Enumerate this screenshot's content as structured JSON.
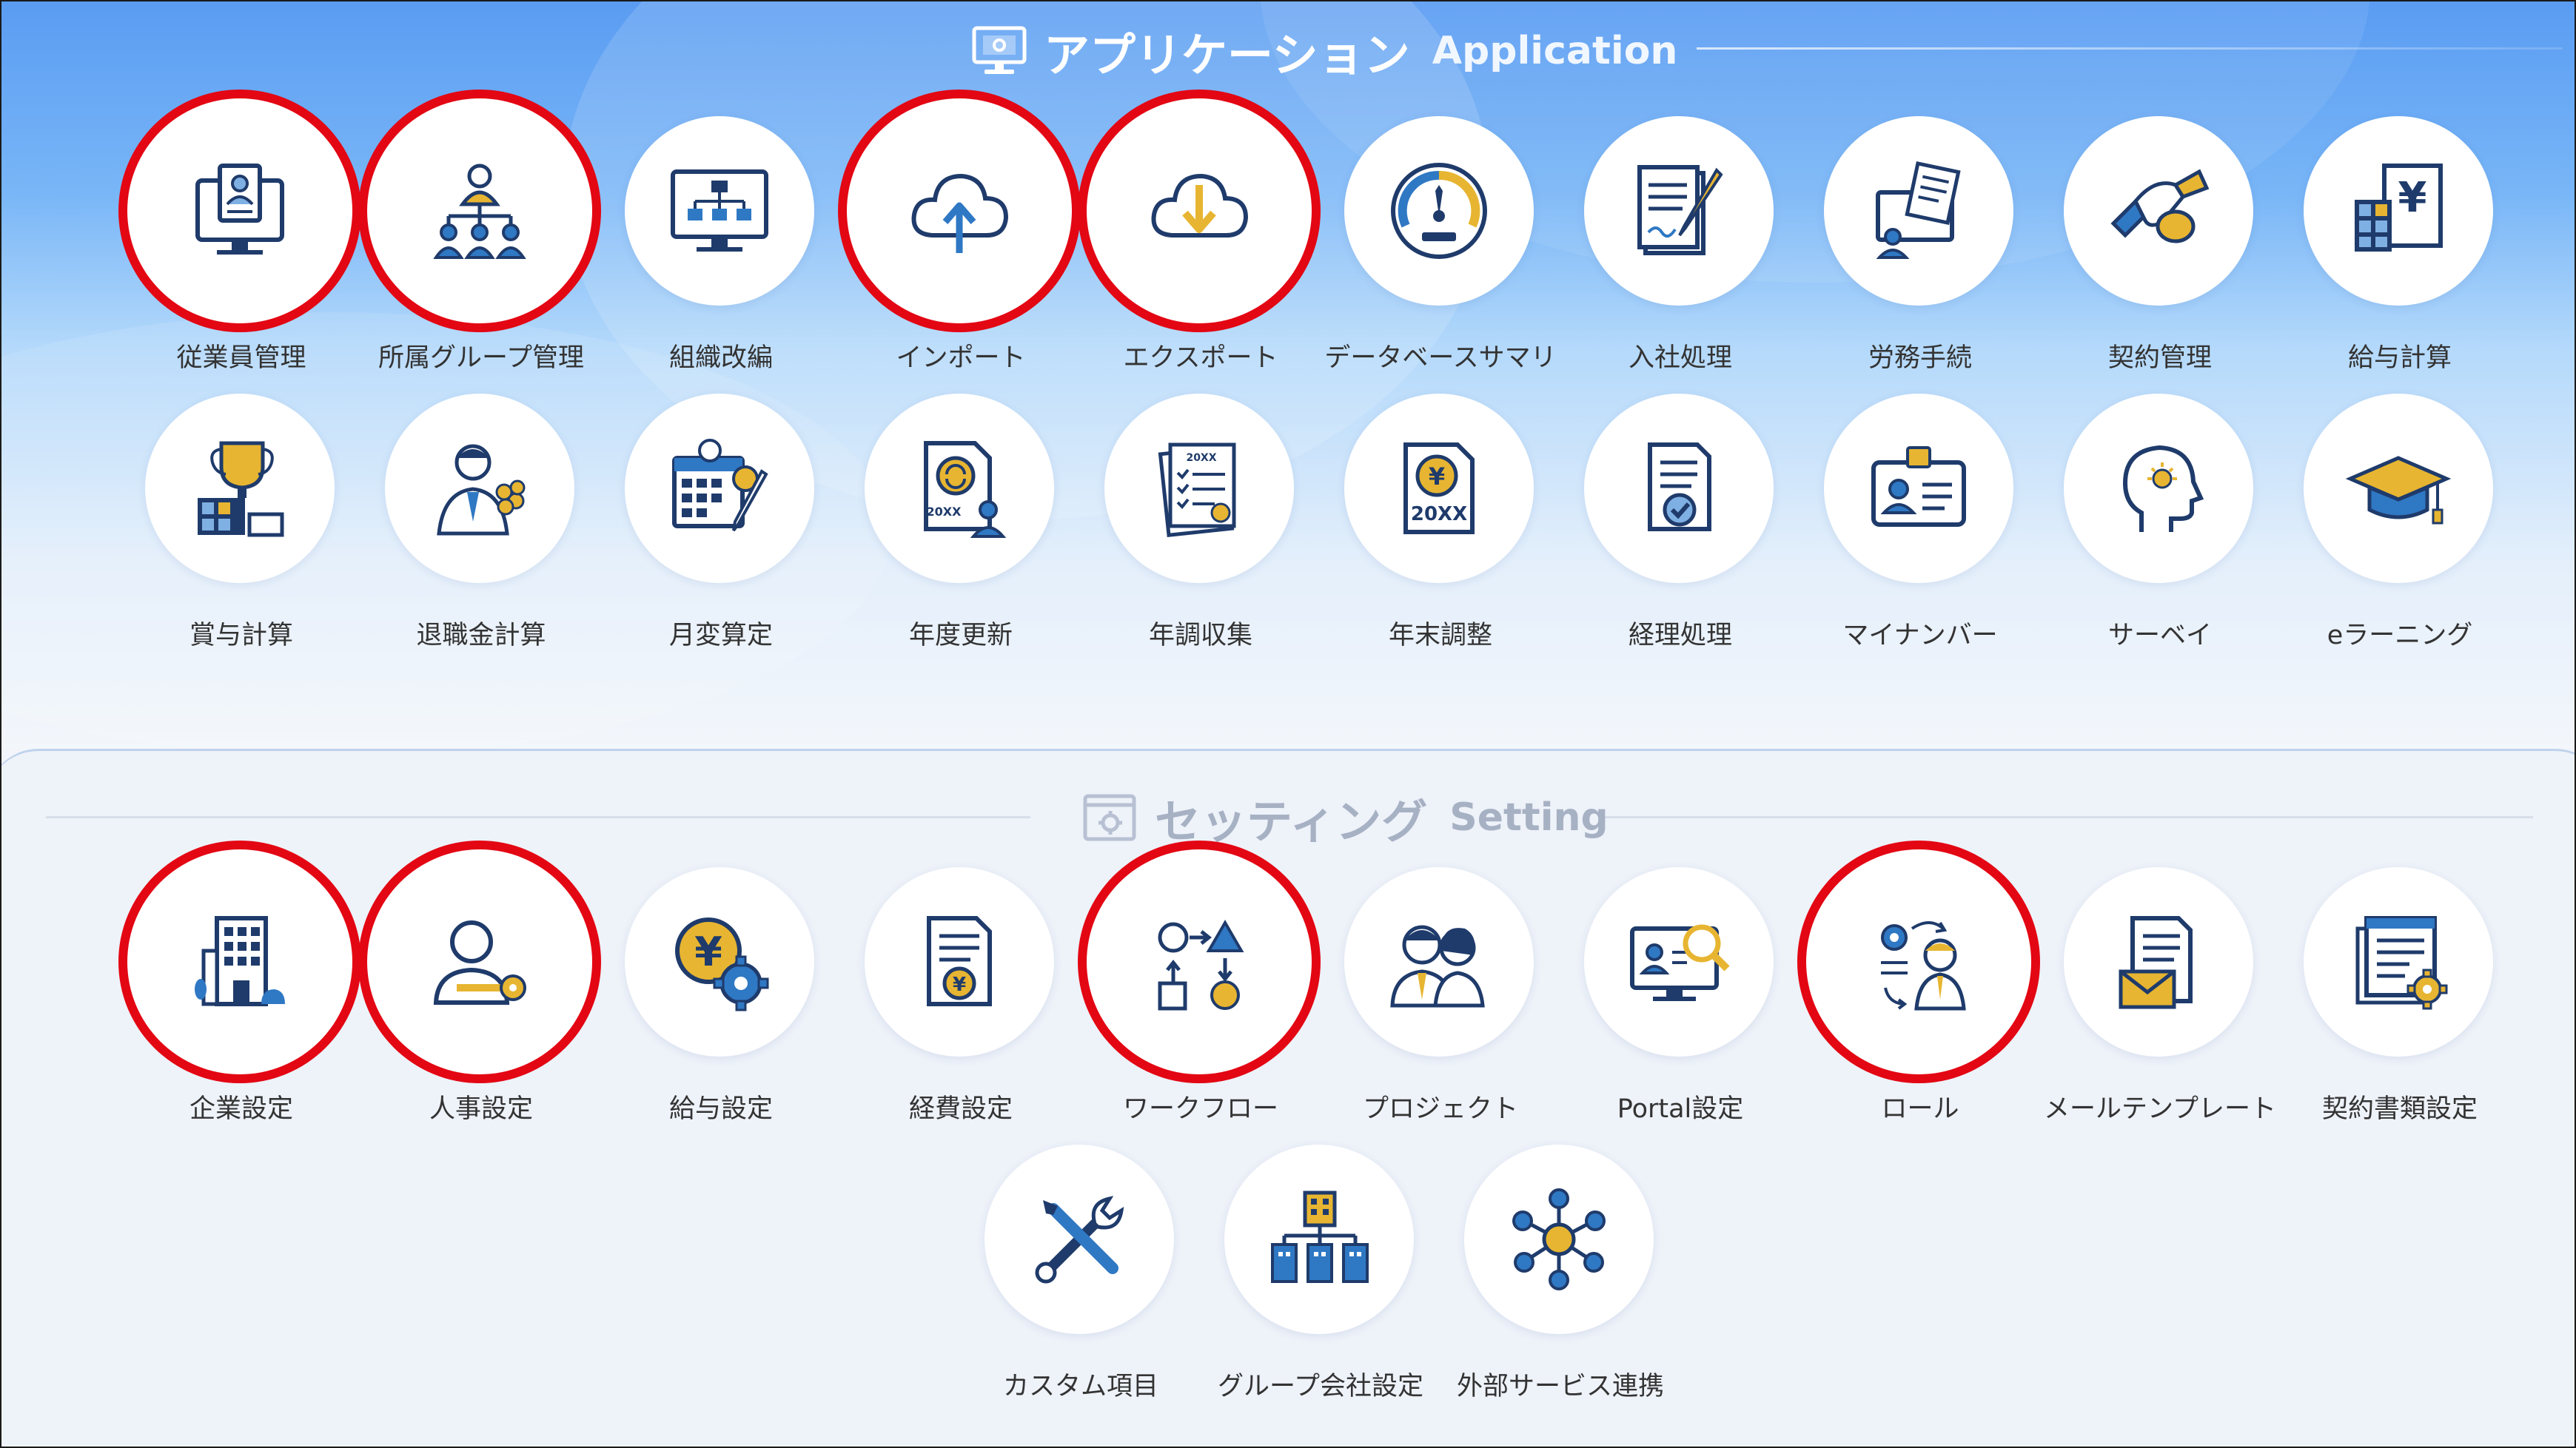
{
  "application_section": {
    "title_jp": "アプリケーション",
    "title_en": "Application",
    "icon": "monitor-settings-icon"
  },
  "setting_section": {
    "title_jp": "セッティング",
    "title_en": "Setting",
    "icon": "window-gear-icon"
  },
  "colors": {
    "highlight_ring": "#e30613",
    "icon_navy": "#1f3b6b",
    "icon_gold": "#e7b531",
    "icon_blue": "#2f78c4"
  },
  "application_tiles": [
    {
      "label": "従業員管理",
      "icon": "employee-card-icon",
      "highlighted": true
    },
    {
      "label": "所属グループ管理",
      "icon": "org-group-icon",
      "highlighted": true
    },
    {
      "label": "組織改編",
      "icon": "org-chart-monitor-icon",
      "highlighted": false
    },
    {
      "label": "インポート",
      "icon": "cloud-upload-icon",
      "highlighted": true
    },
    {
      "label": "エクスポート",
      "icon": "cloud-download-icon",
      "highlighted": true
    },
    {
      "label": "データベースサマリ",
      "icon": "gauge-icon",
      "highlighted": false
    },
    {
      "label": "入社処理",
      "icon": "contract-pen-icon",
      "highlighted": false
    },
    {
      "label": "労務手続",
      "icon": "labor-documents-icon",
      "highlighted": false
    },
    {
      "label": "契約管理",
      "icon": "handshake-icon",
      "highlighted": false
    },
    {
      "label": "給与計算",
      "icon": "payroll-calculator-icon",
      "highlighted": false
    },
    {
      "label": "賞与計算",
      "icon": "bonus-trophy-icon",
      "highlighted": false
    },
    {
      "label": "退職金計算",
      "icon": "retirement-bouquet-icon",
      "highlighted": false
    },
    {
      "label": "月変算定",
      "icon": "calendar-calc-icon",
      "highlighted": false
    },
    {
      "label": "年度更新",
      "icon": "annual-update-icon",
      "highlighted": false
    },
    {
      "label": "年調収集",
      "icon": "year-end-collection-icon",
      "highlighted": false
    },
    {
      "label": "年末調整",
      "icon": "year-end-adjustment-icon",
      "highlighted": false
    },
    {
      "label": "経理処理",
      "icon": "accounting-check-icon",
      "highlighted": false
    },
    {
      "label": "マイナンバー",
      "icon": "id-card-icon",
      "highlighted": false
    },
    {
      "label": "サーベイ",
      "icon": "survey-head-icon",
      "highlighted": false
    },
    {
      "label": "eラーニング",
      "icon": "graduation-cap-icon",
      "highlighted": false
    }
  ],
  "setting_tiles": [
    {
      "label": "企業設定",
      "icon": "company-building-icon",
      "highlighted": true
    },
    {
      "label": "人事設定",
      "icon": "person-key-icon",
      "highlighted": true
    },
    {
      "label": "給与設定",
      "icon": "yen-gear-icon",
      "highlighted": false
    },
    {
      "label": "経費設定",
      "icon": "expense-document-icon",
      "highlighted": false
    },
    {
      "label": "ワークフロー",
      "icon": "workflow-shapes-icon",
      "highlighted": true
    },
    {
      "label": "プロジェクト",
      "icon": "project-team-icon",
      "highlighted": false
    },
    {
      "label": "Portal設定",
      "icon": "portal-search-icon",
      "highlighted": false
    },
    {
      "label": "ロール",
      "icon": "role-gear-icon",
      "highlighted": true
    },
    {
      "label": "メールテンプレート",
      "icon": "mail-template-icon",
      "highlighted": false
    },
    {
      "label": "契約書類設定",
      "icon": "contract-settings-icon",
      "highlighted": false
    },
    {
      "label": "カスタム項目",
      "icon": "tools-icon",
      "highlighted": false
    },
    {
      "label": "グループ会社設定",
      "icon": "group-companies-icon",
      "highlighted": false
    },
    {
      "label": "外部サービス連携",
      "icon": "network-hub-icon",
      "highlighted": false
    }
  ]
}
